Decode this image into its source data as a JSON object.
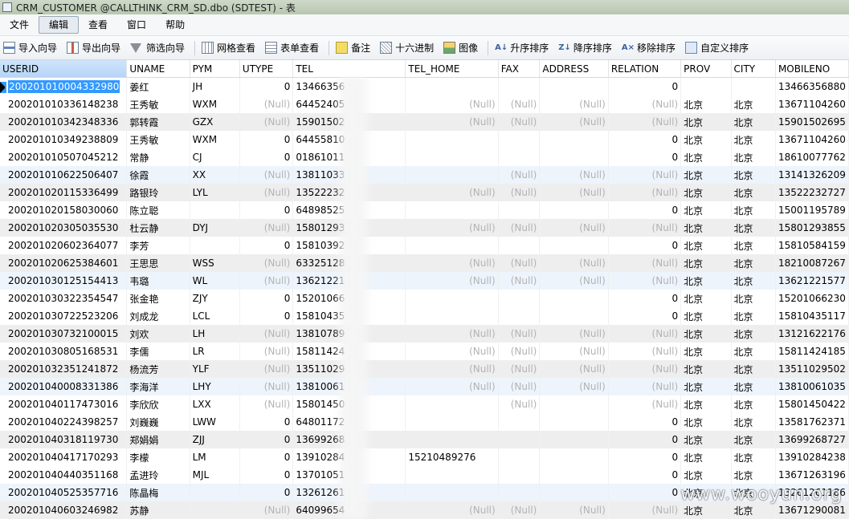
{
  "window": {
    "title": "CRM_CUSTOMER @CALLTHINK_CRM_SD.dbo (SDTEST) - 表"
  },
  "menu": [
    {
      "label": "文件",
      "active": false
    },
    {
      "label": "编辑",
      "active": true
    },
    {
      "label": "查看",
      "active": false
    },
    {
      "label": "窗口",
      "active": false
    },
    {
      "label": "帮助",
      "active": false
    }
  ],
  "toolbar": [
    {
      "label": "导入向导",
      "icon": "import-icon"
    },
    {
      "label": "导出向导",
      "icon": "export-icon"
    },
    {
      "label": "筛选向导",
      "icon": "filter-icon"
    },
    {
      "sep": true
    },
    {
      "label": "网格查看",
      "icon": "grid-view-icon"
    },
    {
      "label": "表单查看",
      "icon": "form-view-icon"
    },
    {
      "sep": true
    },
    {
      "label": "备注",
      "icon": "note-icon"
    },
    {
      "label": "十六进制",
      "icon": "hex-icon"
    },
    {
      "label": "图像",
      "icon": "image-icon"
    },
    {
      "sep": true
    },
    {
      "label": "升序排序",
      "icon": "sort-asc-icon"
    },
    {
      "label": "降序排序",
      "icon": "sort-desc-icon"
    },
    {
      "label": "移除排序",
      "icon": "remove-sort-icon"
    },
    {
      "label": "自定义排序",
      "icon": "custom-sort-icon"
    }
  ],
  "grid": {
    "columns": [
      "USERID",
      "UNAME",
      "PYM",
      "UTYPE",
      "TEL",
      "TEL_HOME",
      "FAX",
      "ADDRESS",
      "RELATION",
      "PROV",
      "CITY",
      "MOBILENO"
    ],
    "null_text": "(Null)",
    "rows": [
      [
        "200201010004332980",
        "姜红",
        "JH",
        "0",
        "13466356",
        "",
        "",
        "",
        "0",
        "",
        "",
        "13466356880"
      ],
      [
        "200201010336148238",
        "王秀敏",
        "WXM",
        "(Null)",
        "64452405",
        "(Null)",
        "(Null)",
        "(Null)",
        "(Null)",
        "北京",
        "北京",
        "13671104260"
      ],
      [
        "200201010342348336",
        "郭转霞",
        "GZX",
        "(Null)",
        "15901502",
        "(Null)",
        "(Null)",
        "(Null)",
        "(Null)",
        "北京",
        "北京",
        "15901502695"
      ],
      [
        "200201010349238809",
        "王秀敏",
        "WXM",
        "0",
        "64455810",
        "",
        "",
        "",
        "0",
        "北京",
        "北京",
        "13671104260"
      ],
      [
        "200201010507045212",
        "常静",
        "CJ",
        "0",
        "01861011",
        "",
        "",
        "",
        "0",
        "北京",
        "北京",
        "18610077762"
      ],
      [
        "200201010622506407",
        "徐霞",
        "XX",
        "(Null)",
        "13811033",
        "",
        "(Null)",
        "(Null)",
        "(Null)",
        "北京",
        "北京",
        "13141326209"
      ],
      [
        "200201020115336499",
        "路银玲",
        "LYL",
        "(Null)",
        "13522232",
        "(Null)",
        "(Null)",
        "(Null)",
        "(Null)",
        "北京",
        "北京",
        "13522232727"
      ],
      [
        "200201020158030060",
        "陈立聪",
        "",
        "0",
        "64898525",
        "",
        "",
        "",
        "0",
        "北京",
        "北京",
        "15001195789"
      ],
      [
        "200201020305035530",
        "杜云静",
        "DYJ",
        "(Null)",
        "15801293",
        "(Null)",
        "(Null)",
        "(Null)",
        "(Null)",
        "北京",
        "北京",
        "15801293855"
      ],
      [
        "200201020602364077",
        "李芳",
        "",
        "0",
        "15810392",
        "",
        "",
        "",
        "0",
        "北京",
        "北京",
        "15810584159"
      ],
      [
        "200201020625384601",
        "王思思",
        "WSS",
        "(Null)",
        "63325128",
        "(Null)",
        "(Null)",
        "(Null)",
        "(Null)",
        "北京",
        "北京",
        "18210087267"
      ],
      [
        "200201030125154413",
        "韦璐",
        "WL",
        "(Null)",
        "13621221",
        "(Null)",
        "(Null)",
        "(Null)",
        "(Null)",
        "北京",
        "北京",
        "13621221577"
      ],
      [
        "200201030322354547",
        "张金艳",
        "ZJY",
        "0",
        "15201066",
        "",
        "",
        "",
        "0",
        "北京",
        "北京",
        "15201066230"
      ],
      [
        "200201030722523206",
        "刘成龙",
        "LCL",
        "0",
        "15810435",
        "",
        "",
        "",
        "0",
        "北京",
        "北京",
        "15810435117"
      ],
      [
        "200201030732100015",
        "刘欢",
        "LH",
        "(Null)",
        "13810789",
        "(Null)",
        "(Null)",
        "(Null)",
        "(Null)",
        "北京",
        "北京",
        "13121622176"
      ],
      [
        "200201030805168531",
        "李儒",
        "LR",
        "(Null)",
        "15811424",
        "(Null)",
        "(Null)",
        "(Null)",
        "(Null)",
        "北京",
        "北京",
        "15811424185"
      ],
      [
        "200201032351241872",
        "杨流芳",
        "YLF",
        "(Null)",
        "13511029",
        "(Null)",
        "(Null)",
        "(Null)",
        "(Null)",
        "北京",
        "北京",
        "13511029502"
      ],
      [
        "200201040008331386",
        "李海洋",
        "LHY",
        "(Null)",
        "13810061",
        "(Null)",
        "(Null)",
        "(Null)",
        "(Null)",
        "北京",
        "北京",
        "13810061035"
      ],
      [
        "200201040117473016",
        "李欣欣",
        "LXX",
        "(Null)",
        "15801450",
        "",
        "(Null)",
        "",
        "(Null)",
        "北京",
        "北京",
        "15801450422"
      ],
      [
        "200201040224398257",
        "刘巍巍",
        "LWW",
        "0",
        "64801172",
        "",
        "",
        "",
        "0",
        "北京",
        "北京",
        "13581762371"
      ],
      [
        "200201040318119730",
        "郑娟娟",
        "ZJJ",
        "0",
        "13699268",
        "",
        "",
        "",
        "0",
        "北京",
        "北京",
        "13699268727"
      ],
      [
        "200201040417170293",
        "李檬",
        "LM",
        "0",
        "13910284",
        "15210489276",
        "",
        "",
        "0",
        "北京",
        "北京",
        "13910284238"
      ],
      [
        "200201040440351168",
        "孟进玲",
        "MJL",
        "0",
        "13701051",
        "",
        "",
        "",
        "0",
        "北京",
        "北京",
        "13671263196"
      ],
      [
        "200201040525357716",
        "陈晶梅",
        "",
        "0",
        "13261261",
        "",
        "",
        "",
        "0",
        "北京",
        "北京",
        "13261261186"
      ],
      [
        "200201040603246982",
        "苏静",
        "",
        "(Null)",
        "64099654",
        "(Null)",
        "(Null)",
        "(Null)",
        "(Null)",
        "北京",
        "北京",
        "13671290081"
      ]
    ]
  },
  "watermark": "www.wooyun.org"
}
